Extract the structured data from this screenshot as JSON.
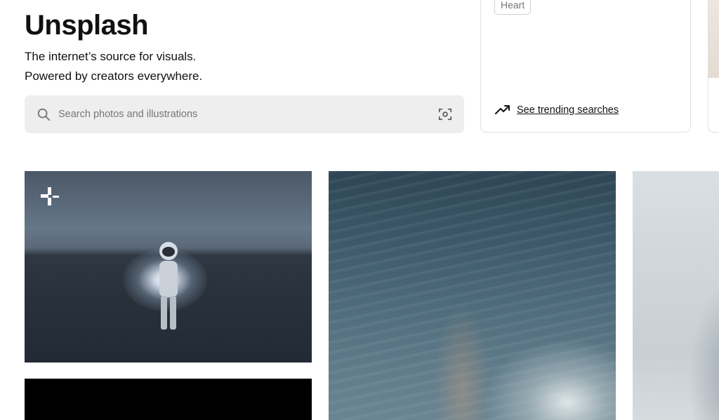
{
  "hero": {
    "title": "Unsplash",
    "tagline_line1": "The internet’s source for visuals.",
    "tagline_line2": "Powered by creators everywhere."
  },
  "search": {
    "placeholder": "Search photos and illustrations",
    "value": "",
    "search_icon": "search-icon",
    "visual_search_icon": "visual-search-icon"
  },
  "trending": {
    "tag": "Heart",
    "link_label": "See trending searches",
    "icon": "trending-up-icon"
  },
  "photos": [
    {
      "subject": "astronaut",
      "badge_icon": "unsplash-plus-icon"
    },
    {
      "subject": "black"
    },
    {
      "subject": "ocean"
    },
    {
      "subject": "fog"
    }
  ],
  "colors": {
    "search_bg": "#eeeeee",
    "text": "#111111",
    "muted": "#767676",
    "border": "#e1e1e1"
  }
}
